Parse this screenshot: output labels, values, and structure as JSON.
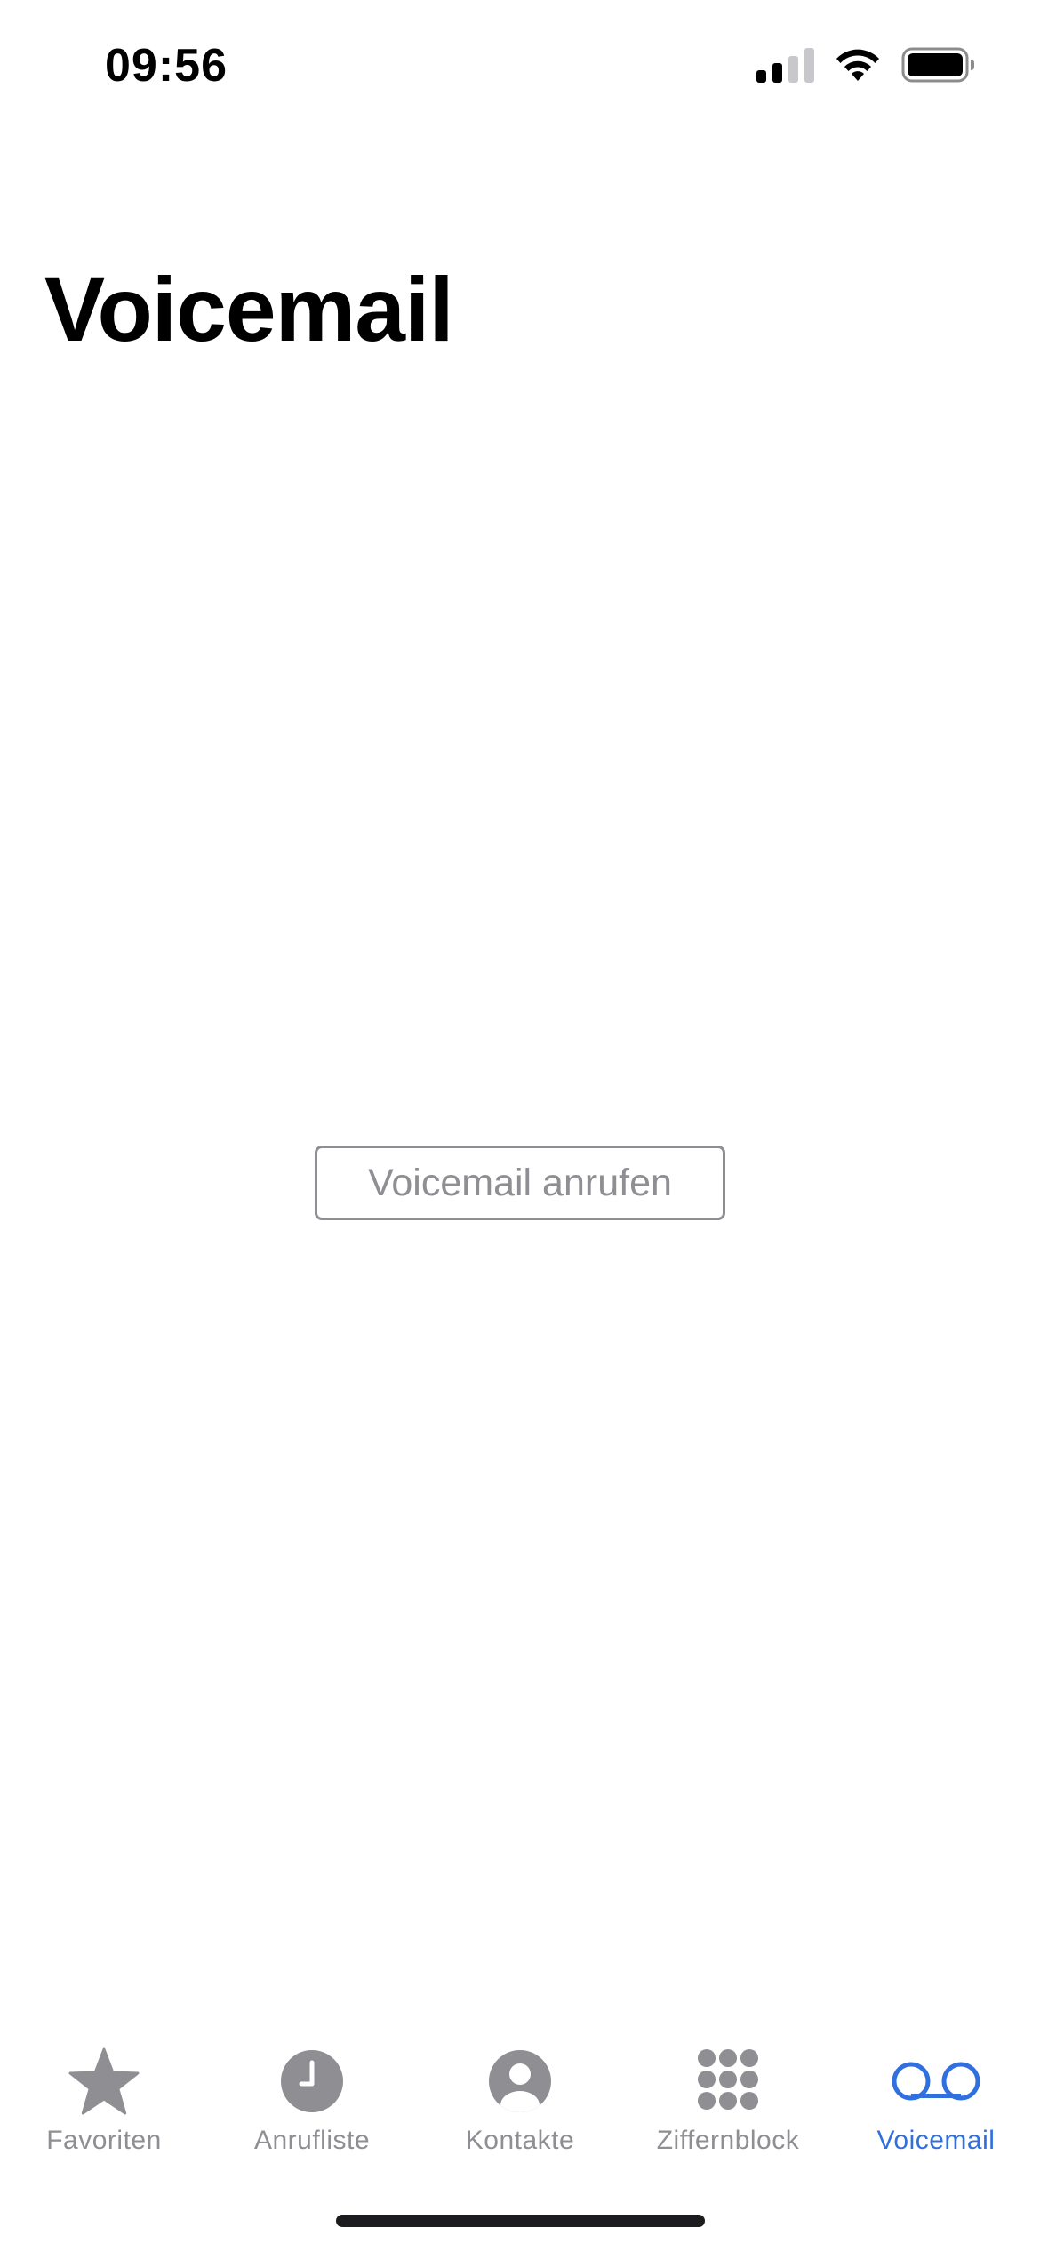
{
  "status_bar": {
    "time": "09:56",
    "signal_icon": "cellular-signal-icon",
    "wifi_icon": "wifi-icon",
    "battery_icon": "battery-icon"
  },
  "header": {
    "title": "Voicemail"
  },
  "main": {
    "call_button_label": "Voicemail anrufen"
  },
  "tab_bar": {
    "active_color": "#2f6fde",
    "inactive_color": "#8e8e93",
    "tabs": [
      {
        "label": "Favoriten",
        "icon": "star-icon",
        "active": false
      },
      {
        "label": "Anrufliste",
        "icon": "clock-icon",
        "active": false
      },
      {
        "label": "Kontakte",
        "icon": "contact-icon",
        "active": false
      },
      {
        "label": "Ziffernblock",
        "icon": "keypad-icon",
        "active": false
      },
      {
        "label": "Voicemail",
        "icon": "voicemail-icon",
        "active": true
      }
    ]
  }
}
